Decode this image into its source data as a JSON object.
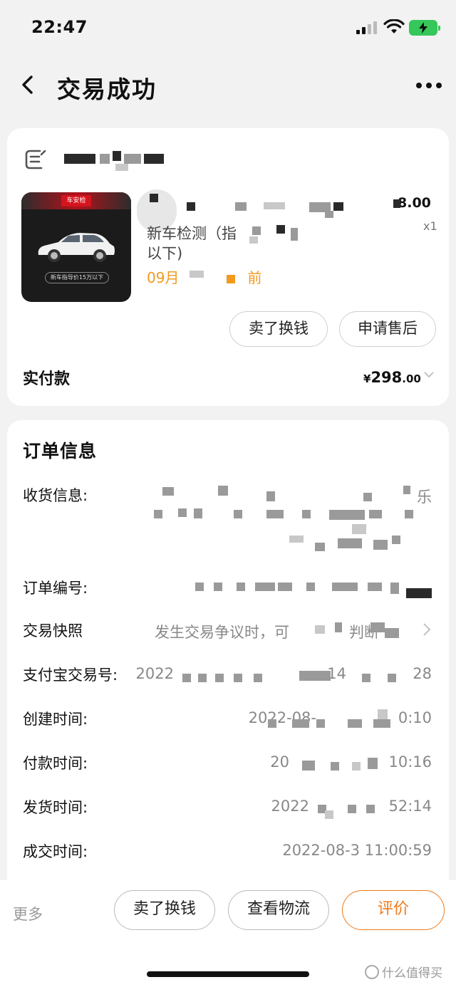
{
  "status": {
    "time": "22:47"
  },
  "nav": {
    "title": "交易成功"
  },
  "product": {
    "thumb_tag": "车安检",
    "thumb_caption": "新车指导价15万以下",
    "title": "新车检测（指",
    "title_line2": "以下)",
    "date": "09月",
    "date_suffix": "前",
    "price": "8.00",
    "qty": "x1",
    "sell_button": "卖了换钱",
    "aftersale_button": "申请售后",
    "paid_label": "实付款",
    "paid_currency": "¥",
    "paid_int": "298",
    "paid_dec": ".00"
  },
  "order": {
    "section_title": "订单信息",
    "rows": [
      {
        "label": "收货信息:",
        "value": "乐"
      },
      {
        "label": "订单编号:",
        "value": ""
      },
      {
        "label": "交易快照",
        "value": "发生交易争议时，可"
      },
      {
        "label": "支付宝交易号:",
        "value": "2022"
      },
      {
        "label": "创建时间:",
        "value": "0:10"
      },
      {
        "label": "付款时间:",
        "value": "10:16"
      },
      {
        "label": "发货时间:",
        "value": "52:14"
      },
      {
        "label": "成交时间:",
        "value": "2022-08-3 11:00:59"
      }
    ],
    "snapshot_suffix": "判断",
    "alipay_suffix": "28",
    "alipay_mid": "14",
    "created_prefix": "2022-08-",
    "paid_prefix": "20",
    "shipped_prefix": "2022"
  },
  "bottom": {
    "more": "更多",
    "sell": "卖了换钱",
    "logistics": "查看物流",
    "review": "评价",
    "watermark": "什么值得买"
  },
  "colors": {
    "accent": "#f07a1a",
    "date": "#f39a1e",
    "battery": "#35c759"
  }
}
